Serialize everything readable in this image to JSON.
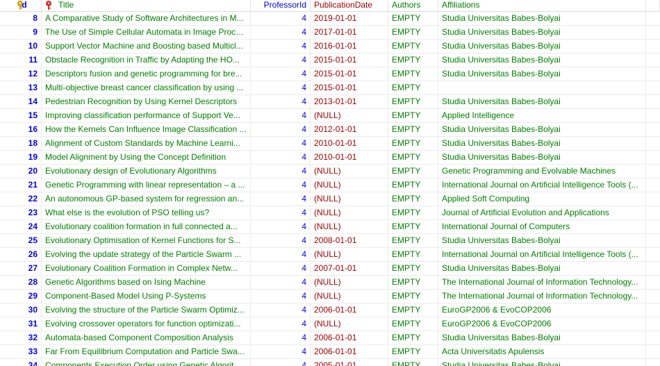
{
  "columns": [
    "id",
    "Title",
    "ProfessorId",
    "PublicationDate",
    "Authors",
    "Affiliations"
  ],
  "colors": {
    "id": "#0000e0",
    "text": "#008000",
    "date": "#a00000",
    "null": "#c06060"
  },
  "rows": [
    [
      "8",
      "A Comparative Study of Software Architectures in M...",
      "4",
      "2019-01-01",
      "EMPTY",
      "Studia Universitas Babes-Bolyai"
    ],
    [
      "9",
      "The Use of Simple Cellular Automata in Image Proce...",
      "4",
      "2017-01-01",
      "EMPTY",
      "Studia Universitas Babes-Bolyai"
    ],
    [
      "10",
      "Support Vector Machine and Boosting based Multicl...",
      "4",
      "2016-01-01",
      "EMPTY",
      "Studia Universitas Babes-Bolyai"
    ],
    [
      "11",
      "Obstacle Recognition in Traffic by Adapting the HO...",
      "4",
      "2015-01-01",
      "EMPTY",
      "Studia Universitas Babes-Bolyai"
    ],
    [
      "12",
      "Descriptors fusion and genetic programming for bre...",
      "4",
      "2015-01-01",
      "EMPTY",
      "Studia Universitas Babes-Bolyai"
    ],
    [
      "13",
      "Multi-objective breast cancer classification by using ...",
      "4",
      "2015-01-01",
      "EMPTY",
      ""
    ],
    [
      "14",
      "Pedestrian Recognition by Using Kernel Descriptors",
      "4",
      "2013-01-01",
      "EMPTY",
      "Studia Universitas Babes-Bolyai"
    ],
    [
      "15",
      "Improving classification performance of Support Ve...",
      "4",
      "(NULL)",
      "EMPTY",
      "Applied Intelligence"
    ],
    [
      "16",
      "How the Kernels Can Influence Image Classification ...",
      "4",
      "2012-01-01",
      "EMPTY",
      "Studia Universitas Babes-Bolyai"
    ],
    [
      "18",
      "Alignment of Custom Standards by Machine Learni...",
      "4",
      "2010-01-01",
      "EMPTY",
      "Studia Universitas Babes-Bolyai"
    ],
    [
      "19",
      "Model Alignment by Using the Concept Definition",
      "4",
      "2010-01-01",
      "EMPTY",
      "Studia Universitas Babes-Bolyai"
    ],
    [
      "20",
      "Evolutionary design of Evolutionary Algorithms",
      "4",
      "(NULL)",
      "EMPTY",
      "Genetic Programming and Evolvable Machines"
    ],
    [
      "21",
      "Genetic Programming with linear representation – a ...",
      "4",
      "(NULL)",
      "EMPTY",
      "International Journal on Artificial Intelligence Tools (..."
    ],
    [
      "22",
      "An autonomous GP-based system for regression an...",
      "4",
      "(NULL)",
      "EMPTY",
      "Applied Soft Computing"
    ],
    [
      "23",
      "What else is the evolution of PSO telling us?",
      "4",
      "(NULL)",
      "EMPTY",
      "Journal of Artificial Evolution and Applications"
    ],
    [
      "24",
      "Evolutionary coalition formation in full connected a...",
      "4",
      "(NULL)",
      "EMPTY",
      "International Journal of Computers"
    ],
    [
      "25",
      "Evolutionary Optimisation of Kernel Functions for S...",
      "4",
      "2008-01-01",
      "EMPTY",
      "Studia Universitas Babes-Bolyai"
    ],
    [
      "26",
      "Evolving the update strategy of the Particle Swarm ...",
      "4",
      "(NULL)",
      "EMPTY",
      "International Journal on Artificial Intelligence Tools (..."
    ],
    [
      "27",
      "Evolutionary Coalition Formation in Complex Netw...",
      "4",
      "2007-01-01",
      "EMPTY",
      "Studia Universitas Babes-Bolyai"
    ],
    [
      "28",
      "Genetic Algorithms based on Ising Machine",
      "4",
      "(NULL)",
      "EMPTY",
      "The International Journal of Information Technology..."
    ],
    [
      "29",
      "Component-Based Model Using P-Systems",
      "4",
      "(NULL)",
      "EMPTY",
      "The International Journal of Information Technology..."
    ],
    [
      "30",
      "Evolving the structure of the Particle Swarm Optimiz...",
      "4",
      "2006-01-01",
      "EMPTY",
      "EuroGP2006 & EvoCOP2006"
    ],
    [
      "31",
      "Evolving crossover operators for function optimizati...",
      "4",
      "(NULL)",
      "EMPTY",
      "EuroGP2006 & EvoCOP2006"
    ],
    [
      "32",
      "Automata-based Component Composition Analysis",
      "4",
      "2006-01-01",
      "EMPTY",
      "Studia Universitas Babes-Bolyai"
    ],
    [
      "33",
      "Far From Equilibrium Computation and Particle Swa...",
      "4",
      "2006-01-01",
      "EMPTY",
      "Acta Universitatis Apulensis"
    ],
    [
      "34",
      "Components Execution Order using Genetic Algorit...",
      "4",
      "2005-01-01",
      "EMPTY",
      "Studia Universitas Babes-Bolyai"
    ]
  ]
}
